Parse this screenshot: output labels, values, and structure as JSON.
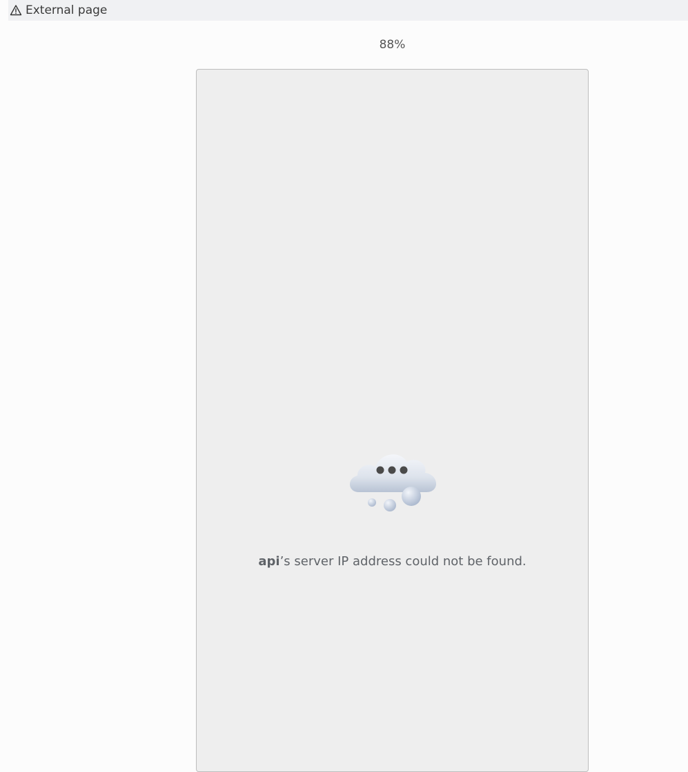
{
  "banner": {
    "icon": "warning-triangle-icon",
    "label": "External page"
  },
  "zoom": {
    "level": "88%"
  },
  "error_page": {
    "icon": "cloud-dots-icon",
    "host": "api",
    "message_rest": "’s server IP address could not be found."
  }
}
